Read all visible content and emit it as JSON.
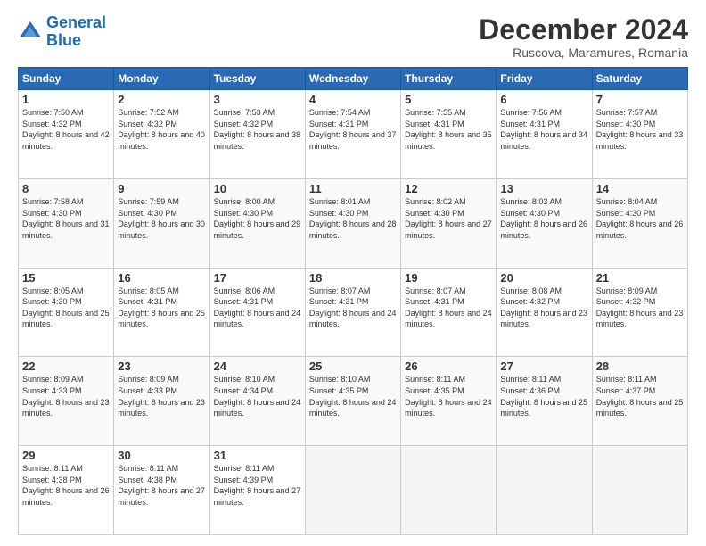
{
  "header": {
    "logo_line1": "General",
    "logo_line2": "Blue",
    "month": "December 2024",
    "location": "Ruscova, Maramures, Romania"
  },
  "days_of_week": [
    "Sunday",
    "Monday",
    "Tuesday",
    "Wednesday",
    "Thursday",
    "Friday",
    "Saturday"
  ],
  "weeks": [
    [
      {
        "day": "1",
        "sunrise": "7:50 AM",
        "sunset": "4:32 PM",
        "daylight": "8 hours and 42 minutes."
      },
      {
        "day": "2",
        "sunrise": "7:52 AM",
        "sunset": "4:32 PM",
        "daylight": "8 hours and 40 minutes."
      },
      {
        "day": "3",
        "sunrise": "7:53 AM",
        "sunset": "4:32 PM",
        "daylight": "8 hours and 38 minutes."
      },
      {
        "day": "4",
        "sunrise": "7:54 AM",
        "sunset": "4:31 PM",
        "daylight": "8 hours and 37 minutes."
      },
      {
        "day": "5",
        "sunrise": "7:55 AM",
        "sunset": "4:31 PM",
        "daylight": "8 hours and 35 minutes."
      },
      {
        "day": "6",
        "sunrise": "7:56 AM",
        "sunset": "4:31 PM",
        "daylight": "8 hours and 34 minutes."
      },
      {
        "day": "7",
        "sunrise": "7:57 AM",
        "sunset": "4:30 PM",
        "daylight": "8 hours and 33 minutes."
      }
    ],
    [
      {
        "day": "8",
        "sunrise": "7:58 AM",
        "sunset": "4:30 PM",
        "daylight": "8 hours and 31 minutes."
      },
      {
        "day": "9",
        "sunrise": "7:59 AM",
        "sunset": "4:30 PM",
        "daylight": "8 hours and 30 minutes."
      },
      {
        "day": "10",
        "sunrise": "8:00 AM",
        "sunset": "4:30 PM",
        "daylight": "8 hours and 29 minutes."
      },
      {
        "day": "11",
        "sunrise": "8:01 AM",
        "sunset": "4:30 PM",
        "daylight": "8 hours and 28 minutes."
      },
      {
        "day": "12",
        "sunrise": "8:02 AM",
        "sunset": "4:30 PM",
        "daylight": "8 hours and 27 minutes."
      },
      {
        "day": "13",
        "sunrise": "8:03 AM",
        "sunset": "4:30 PM",
        "daylight": "8 hours and 26 minutes."
      },
      {
        "day": "14",
        "sunrise": "8:04 AM",
        "sunset": "4:30 PM",
        "daylight": "8 hours and 26 minutes."
      }
    ],
    [
      {
        "day": "15",
        "sunrise": "8:05 AM",
        "sunset": "4:30 PM",
        "daylight": "8 hours and 25 minutes."
      },
      {
        "day": "16",
        "sunrise": "8:05 AM",
        "sunset": "4:31 PM",
        "daylight": "8 hours and 25 minutes."
      },
      {
        "day": "17",
        "sunrise": "8:06 AM",
        "sunset": "4:31 PM",
        "daylight": "8 hours and 24 minutes."
      },
      {
        "day": "18",
        "sunrise": "8:07 AM",
        "sunset": "4:31 PM",
        "daylight": "8 hours and 24 minutes."
      },
      {
        "day": "19",
        "sunrise": "8:07 AM",
        "sunset": "4:31 PM",
        "daylight": "8 hours and 24 minutes."
      },
      {
        "day": "20",
        "sunrise": "8:08 AM",
        "sunset": "4:32 PM",
        "daylight": "8 hours and 23 minutes."
      },
      {
        "day": "21",
        "sunrise": "8:09 AM",
        "sunset": "4:32 PM",
        "daylight": "8 hours and 23 minutes."
      }
    ],
    [
      {
        "day": "22",
        "sunrise": "8:09 AM",
        "sunset": "4:33 PM",
        "daylight": "8 hours and 23 minutes."
      },
      {
        "day": "23",
        "sunrise": "8:09 AM",
        "sunset": "4:33 PM",
        "daylight": "8 hours and 23 minutes."
      },
      {
        "day": "24",
        "sunrise": "8:10 AM",
        "sunset": "4:34 PM",
        "daylight": "8 hours and 24 minutes."
      },
      {
        "day": "25",
        "sunrise": "8:10 AM",
        "sunset": "4:35 PM",
        "daylight": "8 hours and 24 minutes."
      },
      {
        "day": "26",
        "sunrise": "8:11 AM",
        "sunset": "4:35 PM",
        "daylight": "8 hours and 24 minutes."
      },
      {
        "day": "27",
        "sunrise": "8:11 AM",
        "sunset": "4:36 PM",
        "daylight": "8 hours and 25 minutes."
      },
      {
        "day": "28",
        "sunrise": "8:11 AM",
        "sunset": "4:37 PM",
        "daylight": "8 hours and 25 minutes."
      }
    ],
    [
      {
        "day": "29",
        "sunrise": "8:11 AM",
        "sunset": "4:38 PM",
        "daylight": "8 hours and 26 minutes."
      },
      {
        "day": "30",
        "sunrise": "8:11 AM",
        "sunset": "4:38 PM",
        "daylight": "8 hours and 27 minutes."
      },
      {
        "day": "31",
        "sunrise": "8:11 AM",
        "sunset": "4:39 PM",
        "daylight": "8 hours and 27 minutes."
      },
      null,
      null,
      null,
      null
    ]
  ]
}
